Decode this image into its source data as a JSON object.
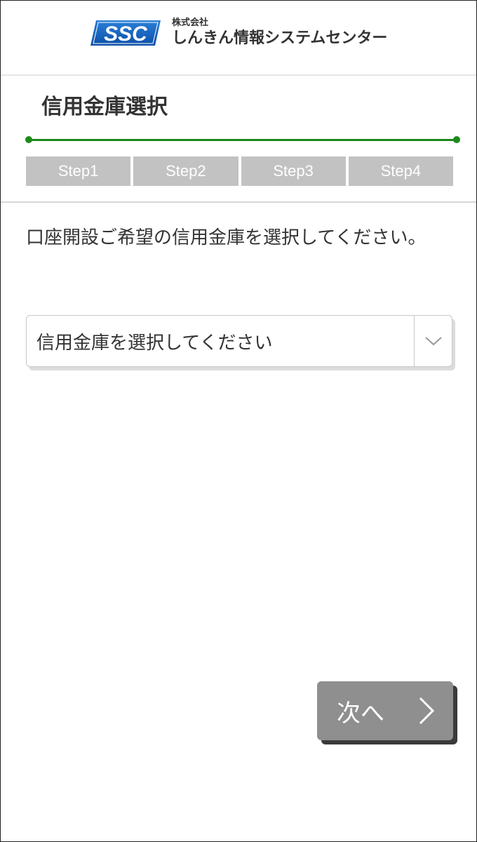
{
  "header": {
    "logo_text": "SSC",
    "company_prefix": "株式会社",
    "company_name": "しんきん情報システムセンター"
  },
  "page": {
    "title": "信用金庫選択",
    "instruction": "口座開設ご希望の信用金庫を選択してください。"
  },
  "steps": [
    "Step1",
    "Step2",
    "Step3",
    "Step4"
  ],
  "bank_select": {
    "selected_text": "信用金庫を選択してください"
  },
  "actions": {
    "next_label": "次へ"
  },
  "colors": {
    "progress_green": "#1a8a1a",
    "step_gray": "#c2c2c2",
    "button_gray": "#8f8f8f",
    "logo_blue": "#1565c0"
  },
  "icons": {
    "dropdown": "chevron-down-icon",
    "next": "chevron-right-icon"
  }
}
